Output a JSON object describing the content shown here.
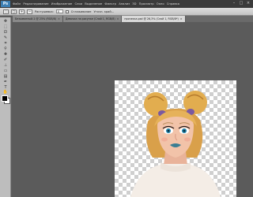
{
  "app": {
    "logo": "Ps"
  },
  "menu": [
    "Файл",
    "Редактирование",
    "Изображение",
    "Слои",
    "Выделение",
    "Фильтр",
    "Анализ",
    "3D",
    "Просмотр",
    "Окно",
    "Справка"
  ],
  "window_controls": [
    "–",
    "□",
    "×"
  ],
  "options": {
    "feather_label": "Растушевка:",
    "feather_value": "0",
    "antialias_label": "Сглаживание",
    "refine_label": "Уточн. край..."
  },
  "tabs": [
    {
      "label": "Безымянный-1 @ 25% (RGB/8)",
      "active": false
    },
    {
      "label": "Девочка на рисунке (Слой 1, RGB/8)",
      "active": false
    },
    {
      "label": "прическа.psd @ 26,3% (Слой 1, RGB/8*)",
      "active": true
    }
  ],
  "colors": {
    "foreground": "#000000",
    "background": "#ffffff",
    "workspace": "#5b5b5b"
  }
}
